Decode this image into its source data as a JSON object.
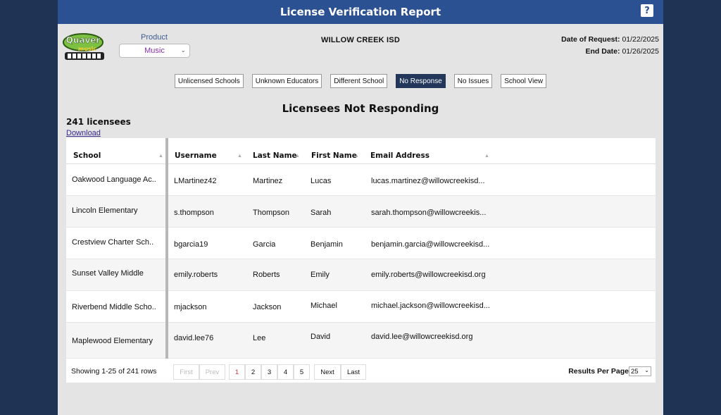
{
  "header": {
    "title": "License Verification Report",
    "help_label": "?"
  },
  "logo": {
    "line1": "Quaver",
    "line2": "music"
  },
  "product": {
    "label": "Product",
    "selected": "Music"
  },
  "district": "WILLOW CREEK ISD",
  "dates": {
    "request_label": "Date of Request:",
    "request_value": "01/22/2025",
    "end_label": "End Date:",
    "end_value": "01/26/2025"
  },
  "filters": [
    {
      "label": "Unlicensed Schools",
      "active": false
    },
    {
      "label": "Unknown Educators",
      "active": false
    },
    {
      "label": "Different School",
      "active": false
    },
    {
      "label": "No Response",
      "active": true
    },
    {
      "label": "No Issues",
      "active": false
    },
    {
      "label": "School View",
      "active": false
    }
  ],
  "section_title": "Licensees Not Responding",
  "count_label": "241 licensees",
  "download_label": "Download",
  "table": {
    "columns": [
      "School",
      "Username",
      "Last Name",
      "First Name",
      "Email Address"
    ],
    "rows": [
      [
        "Oakwood Language Ac..",
        "LMartinez42",
        "Martinez",
        "Lucas",
        "lucas.martinez@willowcreekisd..."
      ],
      [
        "Lincoln Elementary",
        "s.thompson",
        "Thompson",
        "Sarah",
        "sarah.thompson@willowcreekis..."
      ],
      [
        "Crestview Charter Sch..",
        "bgarcia19",
        "Garcia",
        "Benjamin",
        "benjamin.garcia@willowcreekisd..."
      ],
      [
        "Sunset Valley Middle",
        "emily.roberts",
        "Roberts",
        "Emily",
        "emily.roberts@willowcreekisd.org"
      ],
      [
        "Riverbend Middle Scho..",
        "mjackson",
        "Jackson",
        "Michael",
        "michael.jackson@willowcreekisd..."
      ],
      [
        "Maplewood Elementary",
        "david.lee76",
        "Lee",
        "David",
        "david.lee@willowcreekisd.org"
      ]
    ]
  },
  "pager": {
    "showing": "Showing 1-25 of 241 rows",
    "first": "First",
    "prev": "Prev",
    "pages": [
      "1",
      "2",
      "3",
      "4",
      "5"
    ],
    "next": "Next",
    "last": "Last",
    "rpp_label": "Results Per Page",
    "rpp_value": "25"
  }
}
